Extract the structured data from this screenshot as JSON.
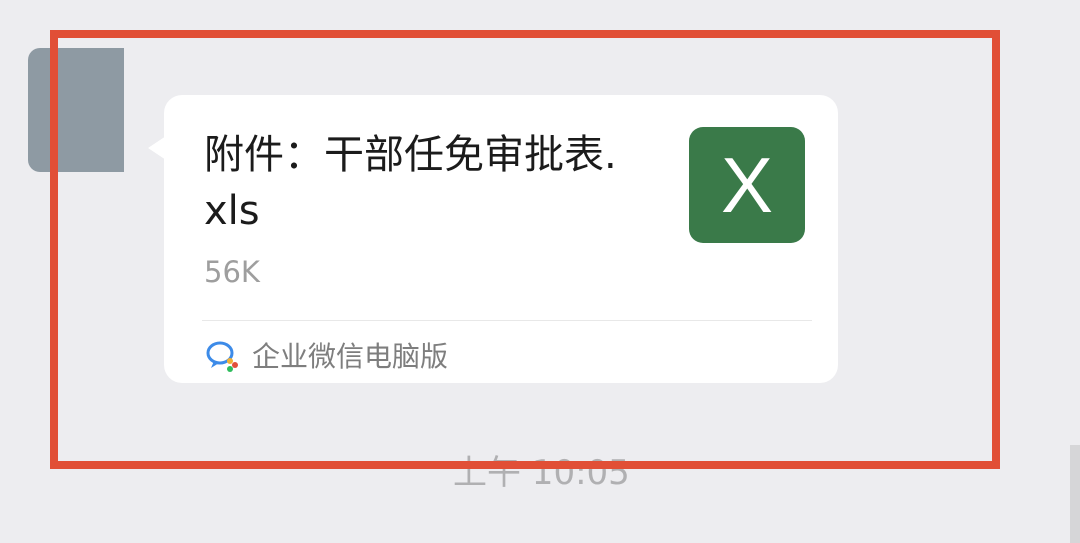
{
  "message": {
    "file_title": "附件：干部任免审批表.xls",
    "file_size": "56K",
    "file_type_icon": "excel-icon",
    "file_type_letter": "X",
    "source_label": "企业微信电脑版",
    "source_icon": "wecom-icon",
    "timestamp": "上午 10:05"
  },
  "colors": {
    "excel_green": "#3a7a49",
    "highlight_red": "#e14f36",
    "background": "#ededf0"
  }
}
